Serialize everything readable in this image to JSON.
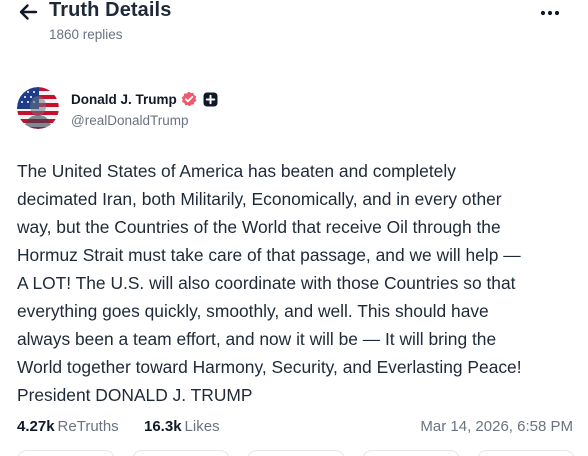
{
  "header": {
    "title": "Truth Details",
    "replies": "1860 replies",
    "back_icon": "arrow-left-icon",
    "more_icon": "more-horizontal-icon"
  },
  "author": {
    "name": "Donald J. Trump",
    "handle": "@realDonaldTrump",
    "verified_color": "#ef5a6f"
  },
  "post": {
    "text": "The United States of America has beaten and completely\ndecimated Iran, both Militarily, Economically, and in every other\nway, but the Countries of the World that receive Oil through the\nHormuz Strait must take care of that passage, and we will help —\nA LOT! The U.S. will also coordinate with those Countries so that\neverything goes quickly, smoothly, and well. This should have\nalways been a team effort, and now it will be — It will bring the\nWorld together toward Harmony, Security, and Everlasting Peace!\nPresident DONALD J. TRUMP"
  },
  "stats": {
    "retruths_count": "4.27k",
    "retruths_label": "ReTruths",
    "likes_count": "16.3k",
    "likes_label": "Likes",
    "timestamp": "Mar 14, 2026, 6:58 PM"
  }
}
